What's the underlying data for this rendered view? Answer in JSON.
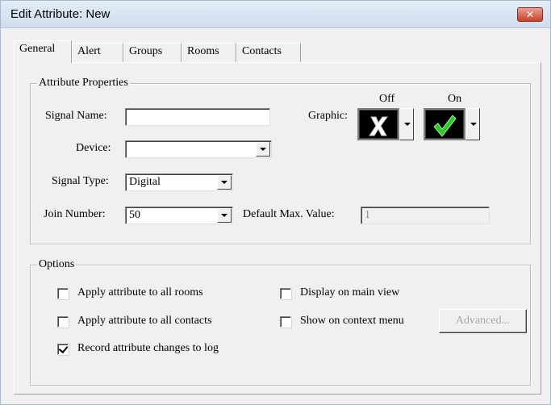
{
  "window": {
    "title": "Edit Attribute: New",
    "close_glyph": "✕"
  },
  "tabs": [
    {
      "label": "General",
      "active": true
    },
    {
      "label": "Alert",
      "active": false
    },
    {
      "label": "Groups",
      "active": false
    },
    {
      "label": "Rooms",
      "active": false
    },
    {
      "label": "Contacts",
      "active": false
    }
  ],
  "attribute_properties": {
    "group_label": "Attribute Properties",
    "signal_name": {
      "label": "Signal Name:",
      "value": ""
    },
    "device": {
      "label": "Device:",
      "value": ""
    },
    "signal_type": {
      "label": "Signal Type:",
      "value": "Digital"
    },
    "join_number": {
      "label": "Join Number:",
      "value": "50"
    },
    "default_max_value": {
      "label": "Default Max. Value:",
      "value": "1"
    },
    "graphic": {
      "label": "Graphic:",
      "off": {
        "label": "Off",
        "icon": "white-x-icon"
      },
      "on": {
        "label": "On",
        "icon": "green-check-icon"
      }
    }
  },
  "options": {
    "group_label": "Options",
    "apply_all_rooms": {
      "label": "Apply attribute to all rooms",
      "checked": false
    },
    "apply_all_contacts": {
      "label": "Apply attribute to all contacts",
      "checked": false
    },
    "record_changes": {
      "label": "Record attribute changes to log",
      "checked": true
    },
    "display_main_view": {
      "label": "Display on main view",
      "checked": false
    },
    "show_context_menu": {
      "label": "Show on context menu",
      "checked": false
    },
    "advanced_button": {
      "label": "Advanced...",
      "enabled": false
    }
  },
  "colors": {
    "titlebar": "#cfddee",
    "close": "#c7412b",
    "check_green": "#2ec82e"
  }
}
